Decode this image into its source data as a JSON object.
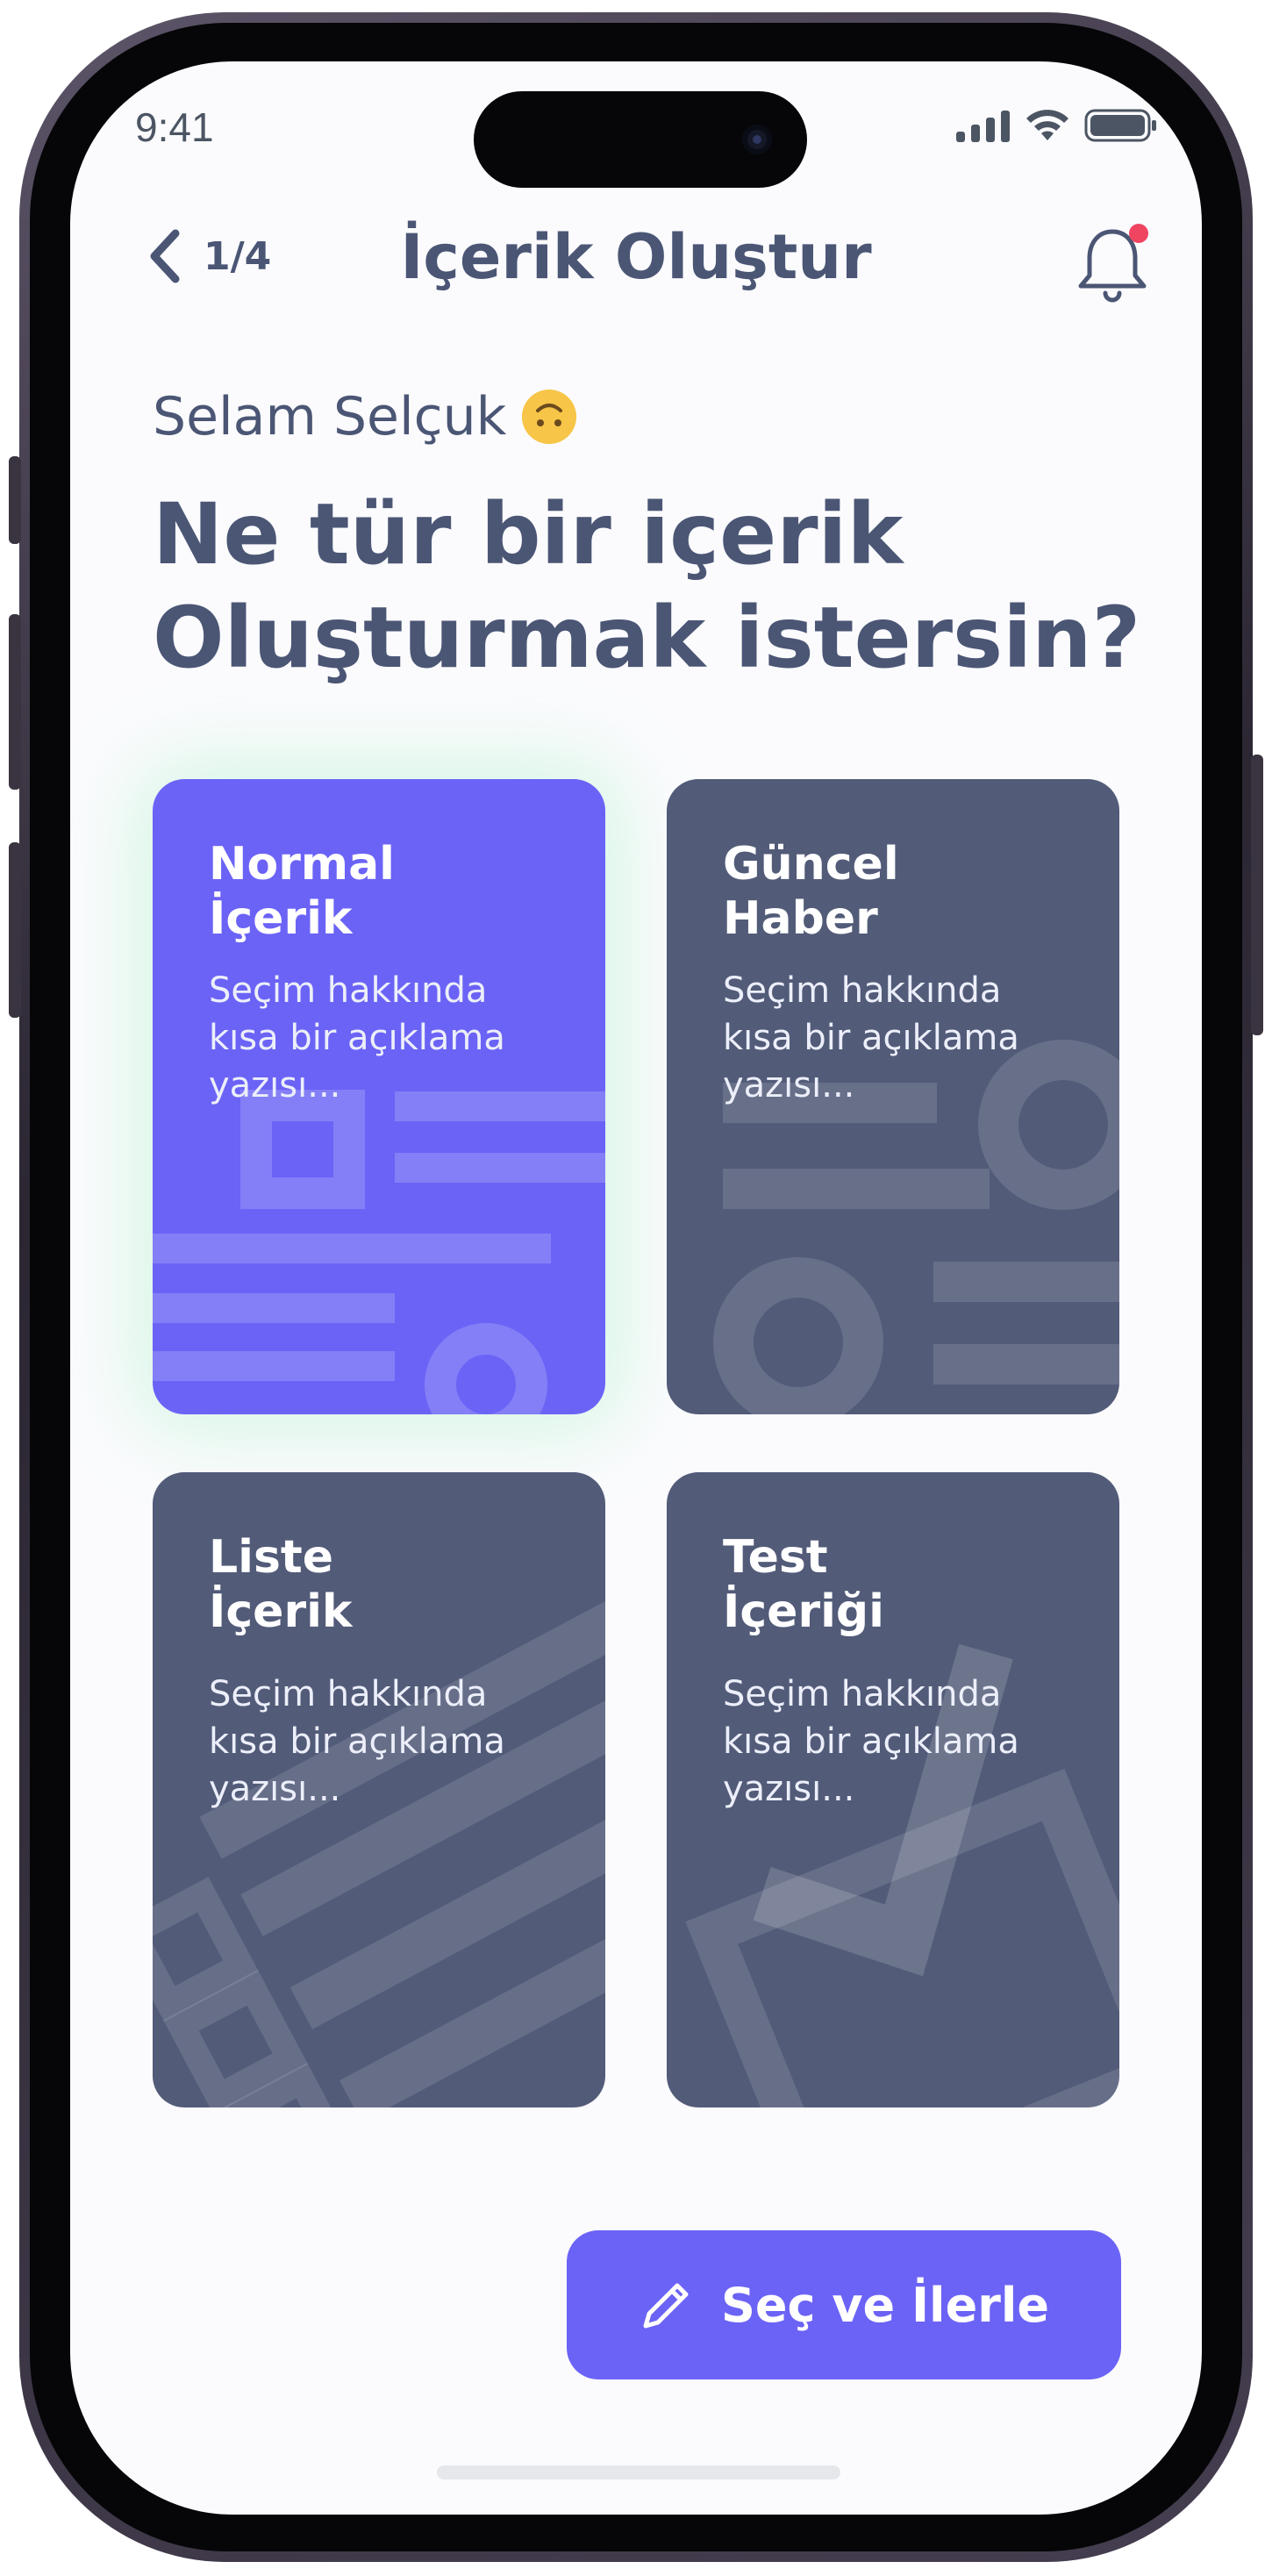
{
  "status_bar": {
    "time": "9:41"
  },
  "header": {
    "step": "1/4",
    "title": "İçerik Oluştur"
  },
  "greeting": {
    "text": "Selam Selçuk"
  },
  "headline": {
    "line1": "Ne tür bir içerik",
    "line2": "Oluşturmak istersin?"
  },
  "cards": [
    {
      "title_line1": "Normal",
      "title_line2": "İçerik",
      "desc_line1": "Seçim hakkında",
      "desc_line2": "kısa bir açıklama",
      "desc_line3": "yazısı...",
      "selected": true
    },
    {
      "title_line1": "Güncel",
      "title_line2": "Haber",
      "desc_line1": "Seçim hakkında",
      "desc_line2": "kısa bir açıklama",
      "desc_line3": "yazısı...",
      "selected": false
    },
    {
      "title_line1": "Liste",
      "title_line2": "İçerik",
      "desc_line1": "Seçim hakkında",
      "desc_line2": "kısa bir açıklama",
      "desc_line3": "yazısı...",
      "selected": false
    },
    {
      "title_line1": "Test",
      "title_line2": "İçeriği",
      "desc_line1": "Seçim hakkında",
      "desc_line2": "kısa bir açıklama",
      "desc_line3": "yazısı...",
      "selected": false
    }
  ],
  "cta": {
    "label": "Seç ve İlerle",
    "icon": "pencil-icon"
  },
  "colors": {
    "accent": "#6b63f6",
    "card": "#525b78",
    "text": "#4b5675",
    "notification": "#ef4561"
  }
}
